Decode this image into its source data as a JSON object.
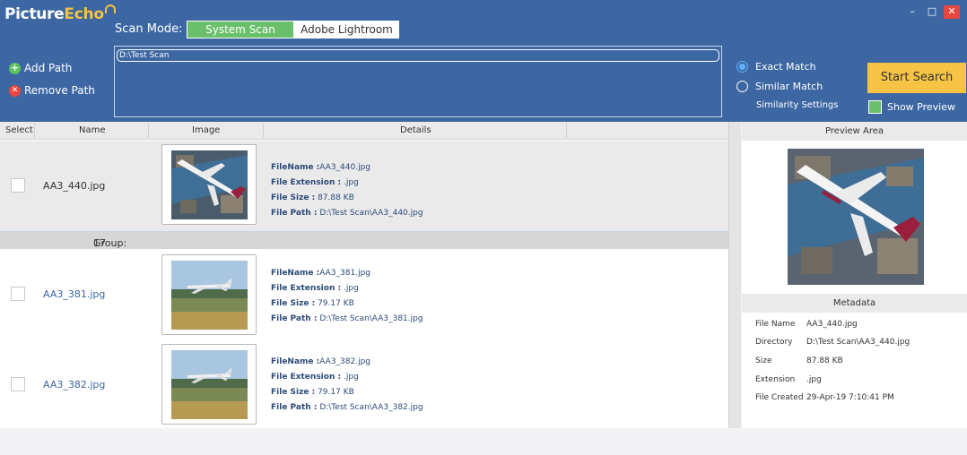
{
  "app": {
    "logo_part1": "Picture",
    "logo_part2": "Echo",
    "scan_mode_label": "Scan Mode:",
    "mode_tabs": [
      "System Scan",
      "Adobe Lightroom"
    ],
    "window_buttons": [
      "–",
      "□",
      "✕"
    ]
  },
  "paths": {
    "add_label": "Add Path",
    "remove_label": "Remove Path",
    "current_path": "D:\\Test Scan"
  },
  "options": {
    "exact_match": "Exact Match",
    "similar_match": "Similar Match",
    "similarity_settings": "Similarity Settings",
    "start_search": "Start Search",
    "show_preview": "Show Preview"
  },
  "columns": [
    "Select",
    "Name",
    "Image",
    "Details"
  ],
  "detail_labels": {
    "filename": "FileName :",
    "extension": "File Extension :",
    "size": "File Size :",
    "path": "File Path  :"
  },
  "rows": [
    {
      "name": "AA3_440.jpg",
      "filename": "AA3_440.jpg",
      "extension": ".jpg",
      "size": "87.88 KB",
      "path": "D:\\Test Scan\\AA3_440.jpg"
    },
    {
      "name": "AA3_381.jpg",
      "filename": "AA3_381.jpg",
      "extension": ".jpg",
      "size": "79.17 KB",
      "path": "D:\\Test Scan\\AA3_381.jpg"
    },
    {
      "name": "AA3_382.jpg",
      "filename": "AA3_382.jpg",
      "extension": ".jpg",
      "size": "79.17 KB",
      "path": "D:\\Test Scan\\AA3_382.jpg"
    }
  ],
  "group": {
    "label": "Group:",
    "number": "17"
  },
  "preview": {
    "title": "Preview Area",
    "metadata_title": "Metadata",
    "meta": [
      {
        "key": "File Name",
        "value": "AA3_440.jpg"
      },
      {
        "key": "Directory",
        "value": "D:\\Test Scan\\AA3_440.jpg"
      },
      {
        "key": "Size",
        "value": "87.88 KB"
      },
      {
        "key": "Extension",
        "value": ".jpg"
      },
      {
        "key": "File Created",
        "value": "29-Apr-19 7:10:41 PM"
      }
    ]
  }
}
